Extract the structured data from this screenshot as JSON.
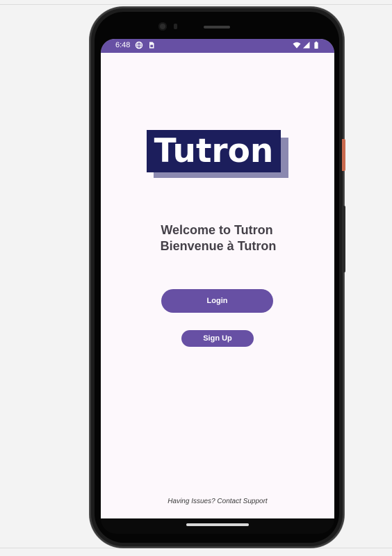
{
  "status_bar": {
    "time": "6:48",
    "left_icons": [
      "globe-icon",
      "sim-card-icon"
    ],
    "right_icons": [
      "wifi-icon",
      "signal-icon",
      "battery-icon"
    ],
    "color": "#6750a4"
  },
  "logo": {
    "text": "Tutron",
    "background_color": "#1c1e5c",
    "shadow_color": "#8b89b0"
  },
  "welcome": {
    "line_en": "Welcome to Tutron",
    "line_fr": "Bienvenue à Tutron"
  },
  "buttons": {
    "login_label": "Login",
    "signup_label": "Sign Up",
    "color": "#6750a4"
  },
  "footer": {
    "support_text": "Having Issues? Contact Support"
  },
  "theme": {
    "screen_background": "#fdf8fc",
    "accent": "#6750a4"
  }
}
